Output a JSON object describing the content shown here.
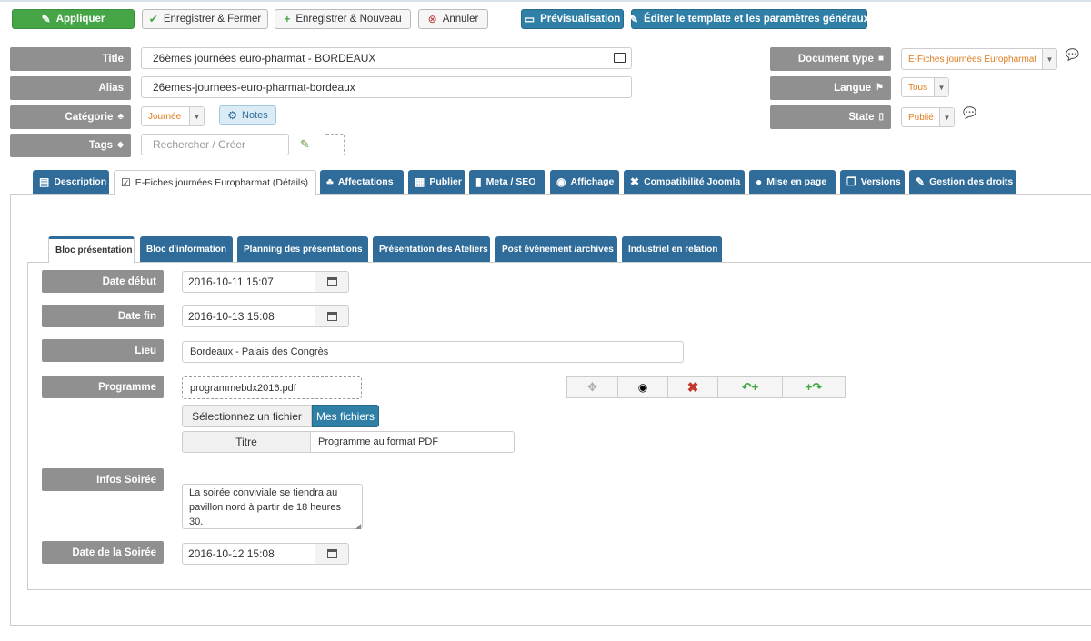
{
  "toolbar": {
    "apply": "Appliquer",
    "save_close": "Enregistrer & Fermer",
    "save_new": "Enregistrer & Nouveau",
    "cancel": "Annuler",
    "preview": "Prévisualisation",
    "edit_template": "Éditer le template et les paramètres généraux"
  },
  "header": {
    "title_label": "Title",
    "title_value": "26èmes journées euro-pharmat - BORDEAUX",
    "alias_label": "Alias",
    "alias_value": "26emes-journees-euro-pharmat-bordeaux",
    "category_label": "Catégorie",
    "category_value": "Journée",
    "notes_label": "Notes",
    "tags_label": "Tags",
    "tags_placeholder": "Rechercher / Créer",
    "doctype_label": "Document type",
    "doctype_value": "E-Fiches journées Europharmat",
    "langue_label": "Langue",
    "langue_value": "Tous",
    "state_label": "State",
    "state_value": "Publié"
  },
  "tabs": [
    {
      "label": "Description",
      "icon": "document-icon"
    },
    {
      "label": "E-Fiches journées Europharmat (Détails)",
      "icon": "clipboard-check-icon"
    },
    {
      "label": "Affectations",
      "icon": "sitemap-icon"
    },
    {
      "label": "Publier",
      "icon": "calendar-icon"
    },
    {
      "label": "Meta / SEO",
      "icon": "bookmark-icon"
    },
    {
      "label": "Affichage",
      "icon": "eye-icon"
    },
    {
      "label": "Compatibilité Joomla",
      "icon": "joomla-icon"
    },
    {
      "label": "Mise en page",
      "icon": "palette-icon"
    },
    {
      "label": "Versions",
      "icon": "copy-icon"
    },
    {
      "label": "Gestion des droits",
      "icon": "wrench-icon"
    }
  ],
  "subtabs": [
    "Bloc présentation",
    "Bloc d'information",
    "Planning des présentations",
    "Présentation des Ateliers",
    "Post événement /archives",
    "Industriel en relation"
  ],
  "form": {
    "date_debut_label": "Date début",
    "date_debut_value": "2016-10-11 15:07",
    "date_fin_label": "Date fin",
    "date_fin_value": "2016-10-13 15:08",
    "lieu_label": "Lieu",
    "lieu_value": "Bordeaux - Palais des Congrès",
    "programme_label": "Programme",
    "programme_file": "programmebdx2016.pdf",
    "select_file": "Sélectionnez un fichier",
    "my_files": "Mes fichiers",
    "titre_label": "Titre",
    "titre_value": "Programme au format PDF",
    "infos_label": "Infos Soirée",
    "infos_value": "La soirée conviviale se tiendra au pavillon nord à partir de 18 heures 30.",
    "date_soiree_label": "Date de la Soirée",
    "date_soiree_value": "2016-10-12 15:08"
  },
  "colors": {
    "apply_green": "#46a546",
    "tab_blue": "#2f6c9a",
    "toolbar_blue": "#2f7fa6",
    "label_gray": "#909090",
    "select_orange": "#e07b1e"
  }
}
